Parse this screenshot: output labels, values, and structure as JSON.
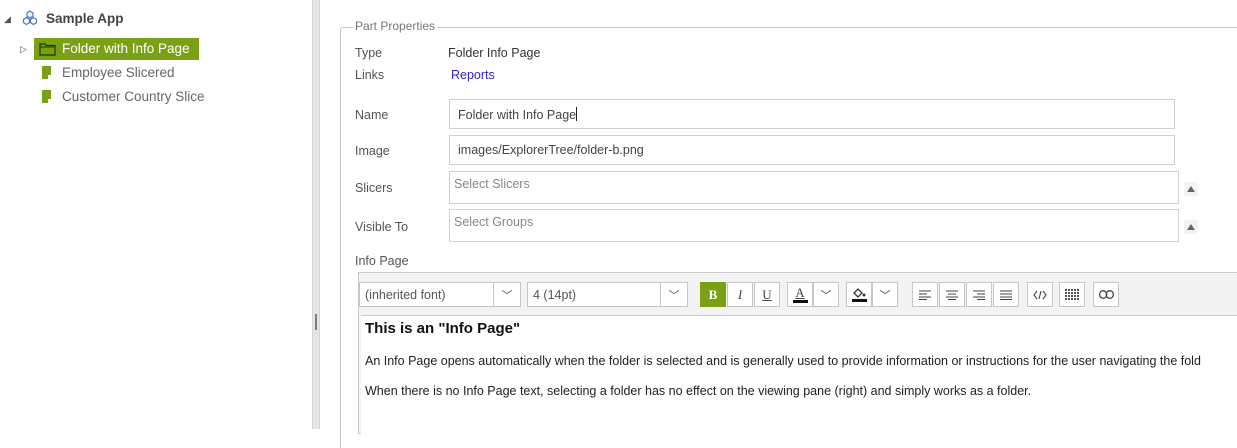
{
  "tree": {
    "app_label": "Sample App",
    "items": [
      {
        "label": "Folder with Info Page",
        "selected": true,
        "icon": "folder-icon"
      },
      {
        "label": "Employee Slicered",
        "icon": "slicer-icon"
      },
      {
        "label": "Customer Country Slice",
        "icon": "slicer-icon"
      }
    ]
  },
  "properties": {
    "legend": "Part Properties",
    "type_label": "Type",
    "type_value": "Folder Info Page",
    "links_label": "Links",
    "links_value": "Reports",
    "name_label": "Name",
    "name_value": "Folder with Info Page",
    "image_label": "Image",
    "image_value": "images/ExplorerTree/folder-b.png",
    "slicers_label": "Slicers",
    "slicers_placeholder": "Select Slicers",
    "visible_label": "Visible To",
    "visible_placeholder": "Select Groups",
    "infopage_label": "Info Page"
  },
  "editor": {
    "font_family": "(inherited font)",
    "font_size": "4 (14pt)",
    "bold": "B",
    "italic": "I",
    "underline": "U",
    "text_color_glyph": "A",
    "heading": "This is an \"Info Page\"",
    "para1": "An Info Page opens automatically when the folder is selected and is generally used to provide information or instructions for the user navigating the fold",
    "para2": "When there is no Info Page text, selecting a folder has no effect on the viewing pane (right) and simply works as a folder."
  },
  "colors": {
    "accent": "#7aa116",
    "link": "#2a2acb"
  }
}
